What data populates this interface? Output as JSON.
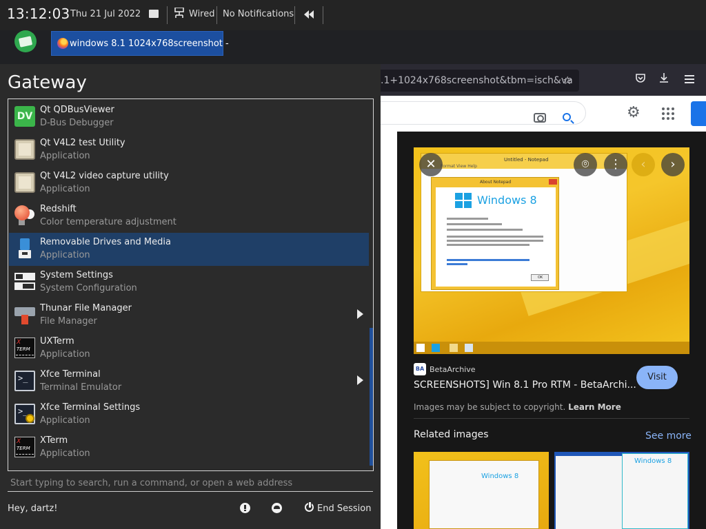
{
  "panel": {
    "clock": "13:12:03",
    "date": "Thu 21 Jul 2022",
    "network": "Wired",
    "notifications": "No Notifications",
    "task_title": "windows 8.1 1024x768screenshot -"
  },
  "menu": {
    "title": "Gateway",
    "items": [
      {
        "name": "Qt QDBusViewer",
        "desc": "D-Bus Debugger",
        "icon": "dbus-viewer-icon"
      },
      {
        "name": "Qt V4L2 test Utility",
        "desc": "Application",
        "icon": "v4l2-test-icon"
      },
      {
        "name": "Qt V4L2 video capture utility",
        "desc": "Application",
        "icon": "v4l2-capture-icon"
      },
      {
        "name": "Redshift",
        "desc": "Color temperature adjustment",
        "icon": "redshift-icon"
      },
      {
        "name": "Removable Drives and Media",
        "desc": "Application",
        "icon": "usb-drive-icon"
      },
      {
        "name": "System Settings",
        "desc": "System Configuration",
        "icon": "settings-icon"
      },
      {
        "name": "Thunar File Manager",
        "desc": "File Manager",
        "icon": "file-manager-icon"
      },
      {
        "name": "UXTerm",
        "desc": "Application",
        "icon": "uxterm-icon"
      },
      {
        "name": "Xfce Terminal",
        "desc": "Terminal Emulator",
        "icon": "terminal-icon"
      },
      {
        "name": "Xfce Terminal Settings",
        "desc": "Application",
        "icon": "terminal-settings-icon"
      },
      {
        "name": "XTerm",
        "desc": "Application",
        "icon": "xterm-icon"
      }
    ],
    "search_placeholder": "Start typing to search, run a command, or open a web address",
    "greeting": "Hey, dartz!",
    "end_session": "End Session"
  },
  "browser": {
    "url": ".1+1024x768screenshot&tbm=isch&va",
    "preview": {
      "source": "BetaArchive",
      "source_icon_text": "BA",
      "title": "SCREENSHOTS] Win 8.1 Pro RTM - BetaArchi...",
      "visit": "Visit",
      "copyright": "Images may be subject to copyright.",
      "learn_more": "Learn More",
      "related": "Related images",
      "see_more": "See more",
      "inner_window_title": "Untitled - Notepad",
      "inner_menu": "Format  View  Help",
      "about_title": "About Notepad",
      "windows_brand": "Windows 8",
      "ok": "OK"
    }
  },
  "colors": {
    "panel_bg": "#242424",
    "menu_bg": "#2b2b2b",
    "selection": "#1f3f67",
    "accent_blue": "#8ab4f8"
  }
}
